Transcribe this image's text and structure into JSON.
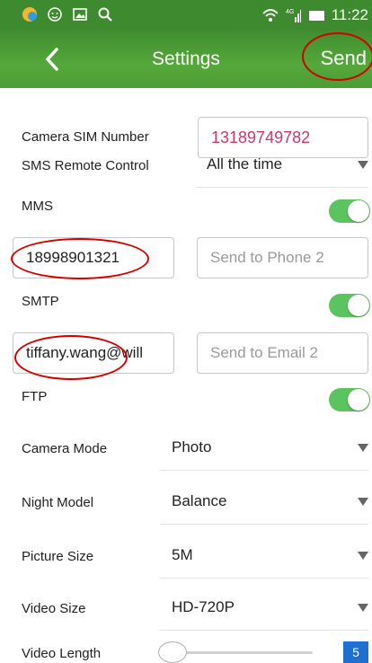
{
  "status_bar": {
    "time": "11:22",
    "left_icons": [
      "app-icon",
      "face-icon",
      "image-icon",
      "search-icon"
    ],
    "right_icons": [
      "wifi-icon",
      "signal-icon",
      "battery-icon"
    ],
    "network_label": "4G"
  },
  "header": {
    "title": "Settings",
    "send_label": "Send"
  },
  "settings": {
    "camera_sim_label": "Camera SIM Number",
    "camera_sim_value": "13189749782",
    "sms_label": "SMS Remote Control",
    "sms_value": "All the time",
    "mms_label": "MMS",
    "mms_enabled": true,
    "phone1_value": "18998901321",
    "phone2_placeholder": "Send to Phone 2",
    "smtp_label": "SMTP",
    "smtp_enabled": true,
    "email1_value": "tiffany.wang@will",
    "email2_placeholder": "Send to Email 2",
    "ftp_label": "FTP",
    "ftp_enabled": true,
    "camera_mode_label": "Camera Mode",
    "camera_mode_value": "Photo",
    "night_model_label": "Night Model",
    "night_model_value": "Balance",
    "picture_size_label": "Picture Size",
    "picture_size_value": "5M",
    "video_size_label": "Video Size",
    "video_size_value": "HD-720P",
    "video_length_label": "Video Length",
    "video_length_value": "5",
    "video_length_slider_fraction": 0.0
  },
  "colors": {
    "header_green": "#4c9d35",
    "toggle_on": "#5cc45f",
    "sim_text": "#d1356b",
    "annotation_red": "#d40000",
    "value_box_blue": "#1e6fd0"
  }
}
